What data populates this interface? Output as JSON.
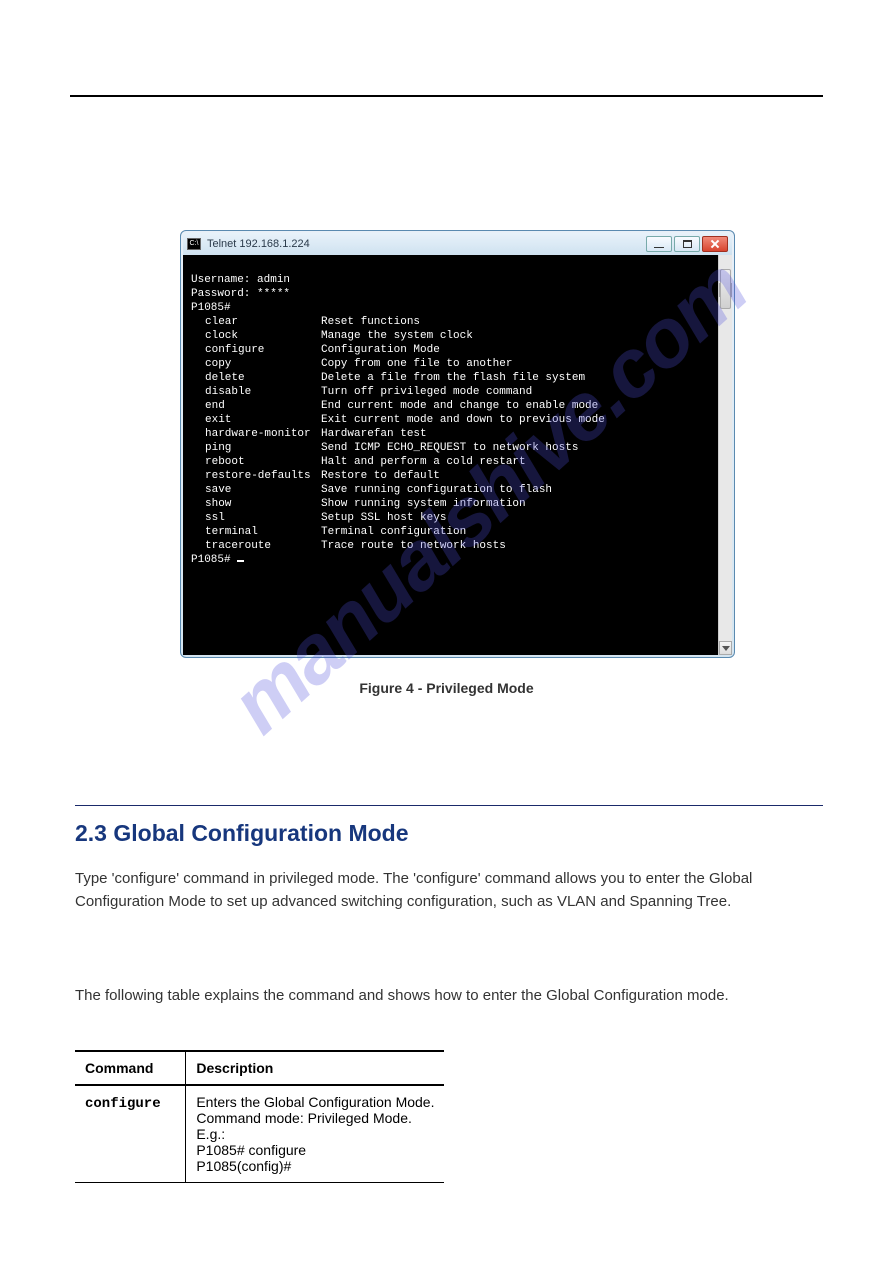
{
  "page_header_rule": true,
  "watermark": "manualshive.com",
  "terminal": {
    "title": "Telnet 192.168.1.224",
    "username_label": "Username:",
    "username_value": "admin",
    "password_label": "Password:",
    "password_value": "*****",
    "prompt": "P1085#",
    "final_prompt": "P1085# ",
    "commands": [
      {
        "cmd": "clear",
        "desc": "Reset functions"
      },
      {
        "cmd": "clock",
        "desc": "Manage the system clock"
      },
      {
        "cmd": "configure",
        "desc": "Configuration Mode"
      },
      {
        "cmd": "copy",
        "desc": "Copy from one file to another"
      },
      {
        "cmd": "delete",
        "desc": "Delete a file from the flash file system"
      },
      {
        "cmd": "disable",
        "desc": "Turn off privileged mode command"
      },
      {
        "cmd": "end",
        "desc": "End current mode and change to enable mode"
      },
      {
        "cmd": "exit",
        "desc": "Exit current mode and down to previous mode"
      },
      {
        "cmd": "hardware-monitor",
        "desc": "Hardwarefan test"
      },
      {
        "cmd": "ping",
        "desc": "Send ICMP ECHO_REQUEST to network hosts"
      },
      {
        "cmd": "reboot",
        "desc": "Halt and perform a cold restart"
      },
      {
        "cmd": "restore-defaults",
        "desc": "Restore to default"
      },
      {
        "cmd": "save",
        "desc": "Save running configuration to flash"
      },
      {
        "cmd": "show",
        "desc": "Show running system information"
      },
      {
        "cmd": "ssl",
        "desc": "Setup SSL host keys"
      },
      {
        "cmd": "terminal",
        "desc": "Terminal configuration"
      },
      {
        "cmd": "traceroute",
        "desc": "Trace route to network hosts"
      }
    ]
  },
  "figure_caption": "Figure 4 - Privileged Mode",
  "section": {
    "heading": "2.3 Global Configuration Mode",
    "para1": "Type 'configure' command in privileged mode. The 'configure' command allows you to enter the Global Configuration Mode to set up advanced switching configuration, such as VLAN and Spanning Tree.",
    "para2": "The following table explains the command and shows how to enter the Global Configuration mode."
  },
  "table": {
    "headers": [
      "Command",
      "Description"
    ],
    "rows": [
      {
        "cmd": "configure",
        "desc": "Enters the Global Configuration Mode.\nCommand mode: Privileged Mode.\nE.g.:\nP1085# configure\nP1085(config)#"
      }
    ]
  }
}
